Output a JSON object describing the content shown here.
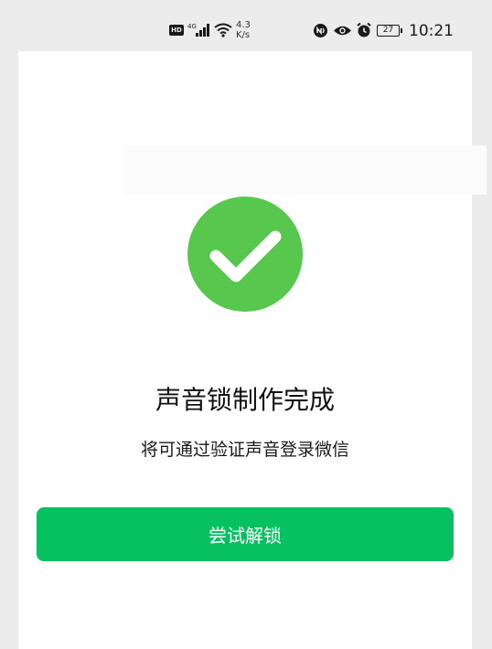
{
  "status_bar": {
    "hd_label": "HD",
    "signal_label": "4G",
    "net_speed_value": "4.3",
    "net_speed_unit": "K/s",
    "battery_level": "27",
    "time": "10:21"
  },
  "result": {
    "title": "声音锁制作完成",
    "subtitle": "将可通过验证声音登录微信"
  },
  "actions": {
    "try_unlock_label": "尝试解锁"
  },
  "colors": {
    "success_green": "#57c84d",
    "button_green": "#07c160",
    "page_background": "#ececec",
    "panel_background": "#ffffff"
  },
  "icons": {
    "success": "checkmark-circle-icon",
    "nfc": "nfc-icon",
    "eye": "eye-icon",
    "alarm": "alarm-clock-icon",
    "wifi": "wifi-icon",
    "signal": "signal-bars-icon"
  }
}
